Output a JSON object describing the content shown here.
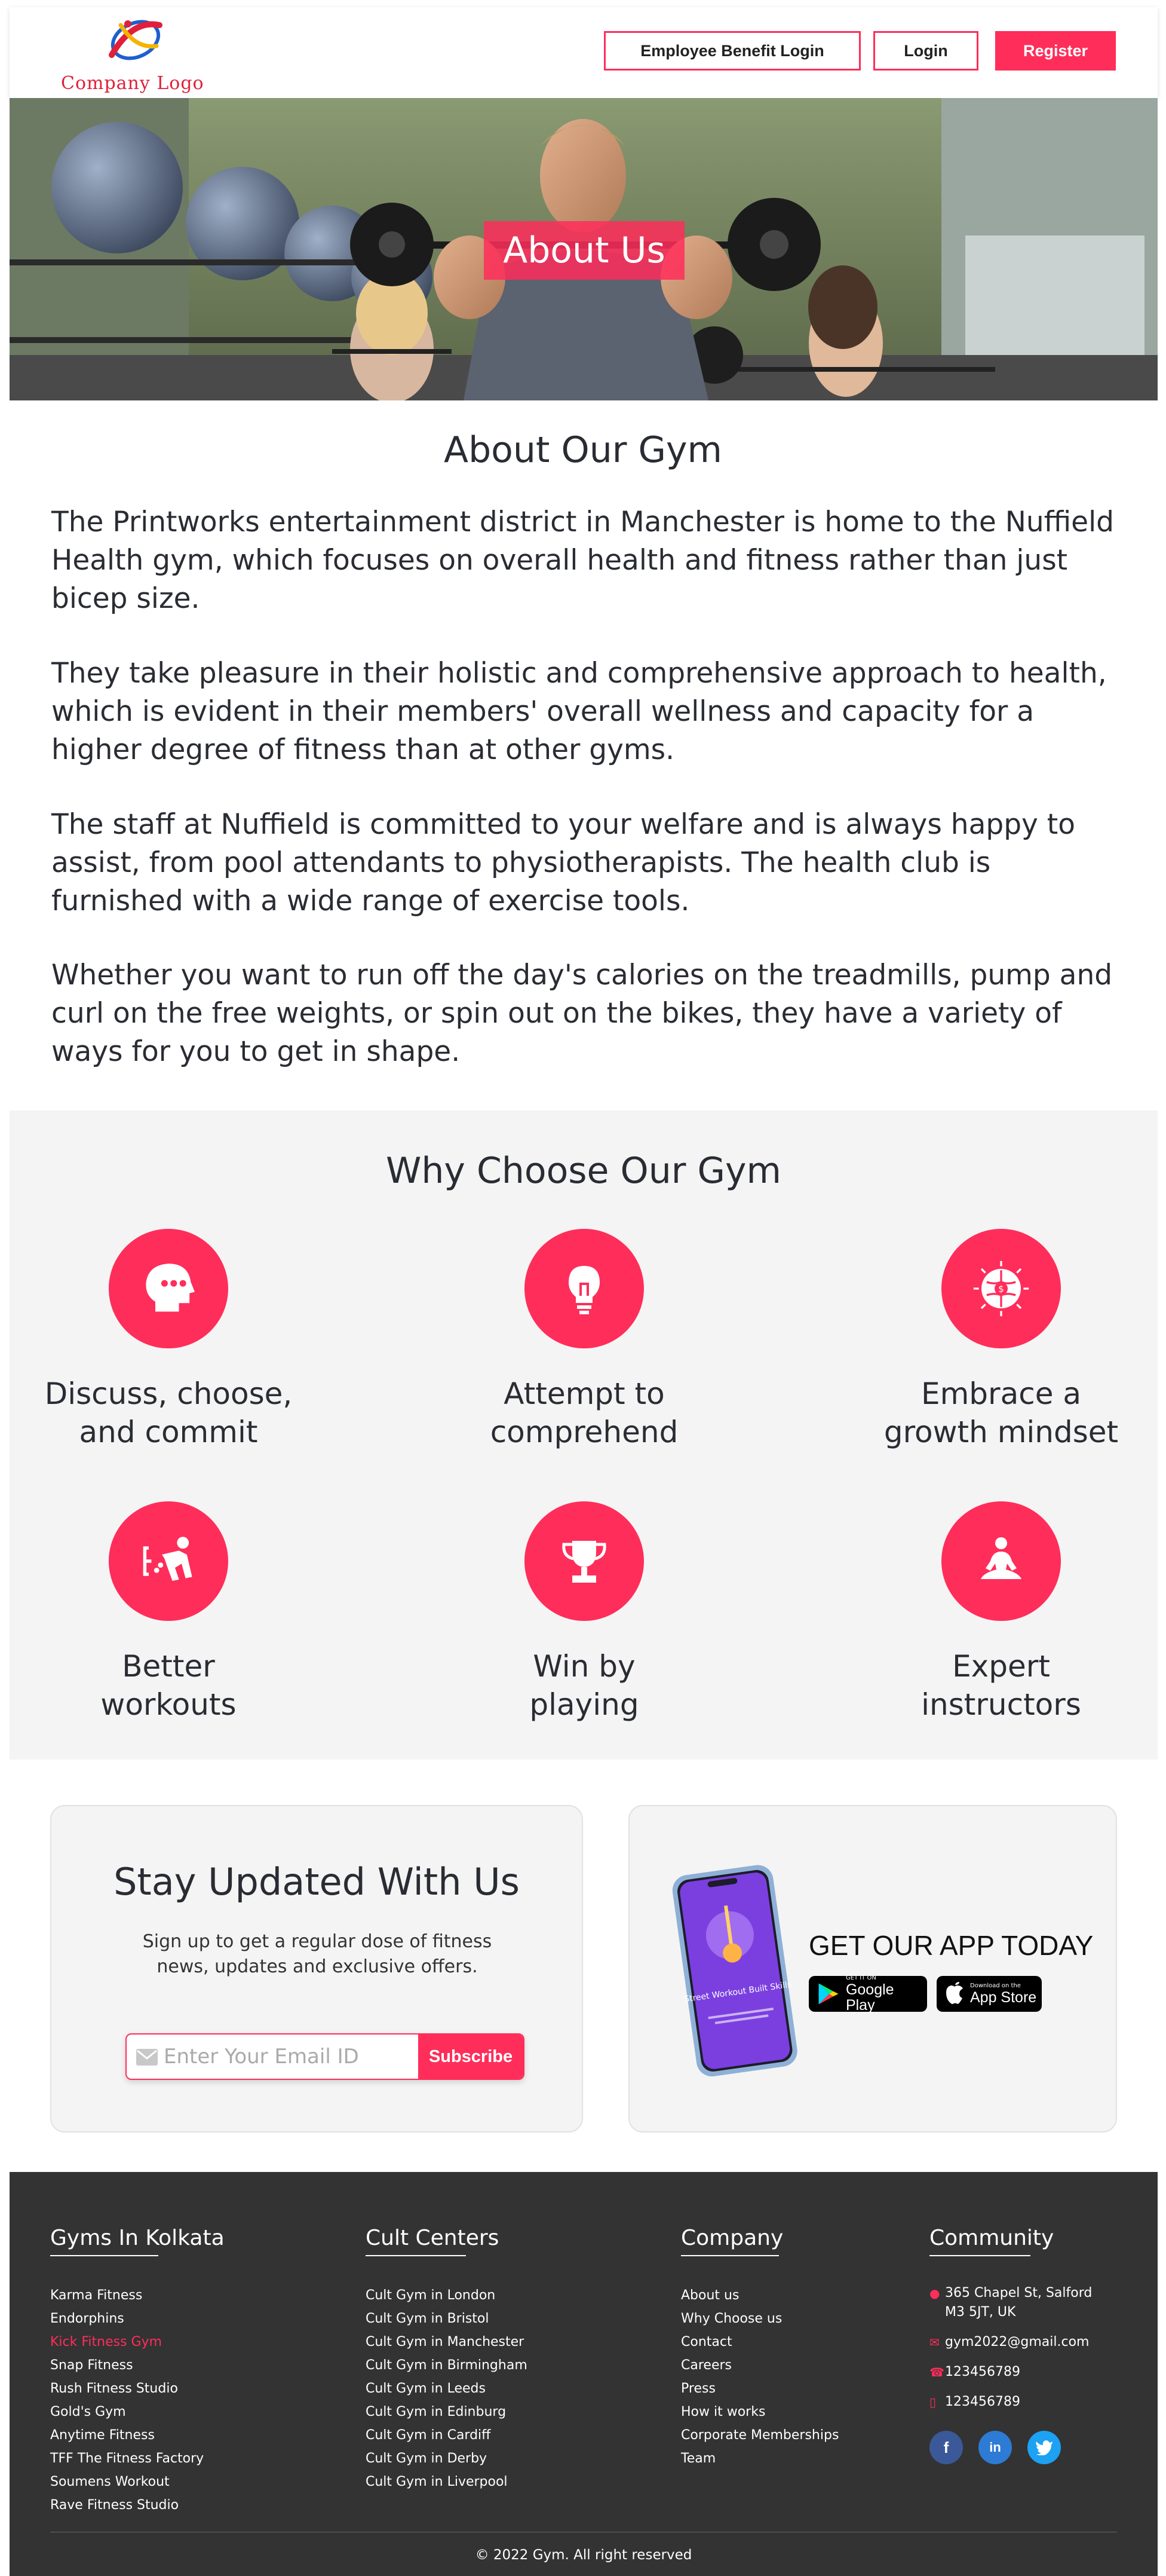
{
  "header": {
    "logo_text": "Company Logo",
    "employee_login_label": "Employee Benefit Login",
    "login_label": "Login",
    "register_label": "Register"
  },
  "hero": {
    "title": "About Us"
  },
  "about": {
    "heading": "About Our Gym",
    "paragraphs": [
      "The Printworks entertainment district in Manchester is home to the Nuffield Health gym, which focuses on overall health and fitness rather than just bicep size.",
      "They take pleasure in their holistic and comprehensive approach to health, which is evident in their members' overall wellness and capacity for a higher degree of fitness than at other gyms.",
      "The staff at Nuffield is committed to your welfare and is always happy to assist, from pool attendants to physiotherapists. The health club is furnished with a wide range of exercise tools.",
      "Whether you want to run off the day's calories on the treadmills, pump and curl on the free weights, or spin out on the bikes, they have a variety of ways for you to get in shape."
    ]
  },
  "why": {
    "heading": "Why Choose Our Gym",
    "features": [
      {
        "line1": "Discuss, choose,",
        "line2": "and commit",
        "icon": "discuss-head-icon"
      },
      {
        "line1": "Attempt to",
        "line2": "comprehend",
        "icon": "lightbulb-icon"
      },
      {
        "line1": "Embrace a",
        "line2": "growth mindset",
        "icon": "brain-icon"
      },
      {
        "line1": "Better",
        "line2": "workouts",
        "icon": "workout-icon"
      },
      {
        "line1": "Win by",
        "line2": "playing",
        "icon": "trophy-icon"
      },
      {
        "line1": "Expert",
        "line2": "instructors",
        "icon": "meditation-icon"
      }
    ]
  },
  "newsletter": {
    "heading": "Stay Updated With Us",
    "subtext": "Sign up to get a regular dose of fitness news, updates and exclusive offers.",
    "email_placeholder": "Enter Your Email ID",
    "subscribe_label": "Subscribe"
  },
  "app": {
    "heading": "GET OUR APP TODAY",
    "phone_title": "Street Workout Built Skills",
    "google_small": "GET IT ON",
    "google_big": "Google Play",
    "apple_small": "Download on the",
    "apple_big": "App Store"
  },
  "footer": {
    "col1": {
      "heading": "Gyms In Kolkata",
      "items": [
        "Karma Fitness",
        "Endorphins",
        "Kick Fitness Gym",
        "Snap Fitness",
        "Rush Fitness Studio",
        "Gold's Gym",
        "Anytime Fitness",
        "TFF The Fitness Factory",
        "Soumens Workout",
        "Rave Fitness Studio"
      ]
    },
    "col2": {
      "heading": "Cult Centers",
      "items": [
        "Cult Gym in London",
        "Cult Gym in Bristol",
        "Cult Gym in Manchester",
        "Cult Gym in Birmingham",
        "Cult Gym in Leeds",
        "Cult Gym in Edinburg",
        "Cult Gym in Cardiff",
        "Cult Gym in Derby",
        "Cult Gym in Liverpool"
      ]
    },
    "col3": {
      "heading": "Company",
      "items": [
        "About us",
        "Why Choose us",
        "Contact",
        "Careers",
        "Press",
        "How it works",
        "Corporate Memberships",
        "Team"
      ]
    },
    "col4": {
      "heading": "Community",
      "address_line1": "365 Chapel St, Salford",
      "address_line2": "M3 5JT, UK",
      "email": "gym2022@gmail.com",
      "whatsapp": "123456789",
      "phone": "123456789"
    },
    "copyright": "© 2022 Gym. All right reserved"
  },
  "colors": {
    "accent": "#ff2d5a",
    "footer_bg": "#333333",
    "section_bg": "#f4f4f4",
    "facebook": "#3b5998",
    "linkedin": "#2d7bd4",
    "twitter": "#1da1f2"
  }
}
